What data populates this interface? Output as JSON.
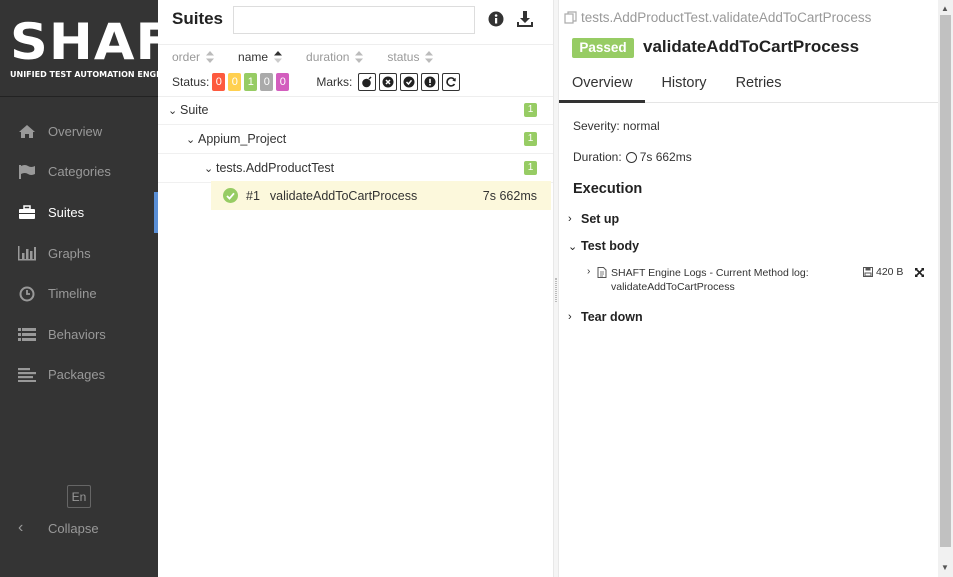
{
  "sidebar": {
    "logo_big": "SHAFT",
    "logo_small": "UNIFIED TEST AUTOMATION ENGINE",
    "items": [
      {
        "label": "Overview",
        "icon": "home-icon"
      },
      {
        "label": "Categories",
        "icon": "flag-icon"
      },
      {
        "label": "Suites",
        "icon": "briefcase-icon",
        "active": true
      },
      {
        "label": "Graphs",
        "icon": "bar-chart-icon"
      },
      {
        "label": "Timeline",
        "icon": "clock-icon"
      },
      {
        "label": "Behaviors",
        "icon": "list-icon"
      },
      {
        "label": "Packages",
        "icon": "align-left-icon"
      }
    ],
    "lang": "En",
    "collapse": "Collapse"
  },
  "suites": {
    "title": "Suites",
    "search_value": "",
    "sort": {
      "order": "order",
      "name": "name",
      "duration": "duration",
      "status": "status"
    },
    "status_label": "Status:",
    "status_counts": [
      {
        "value": "0",
        "color": "#fd5a3e"
      },
      {
        "value": "0",
        "color": "#ffd050"
      },
      {
        "value": "1",
        "color": "#97cc64"
      },
      {
        "value": "0",
        "color": "#aaaaaa"
      },
      {
        "value": "0",
        "color": "#d35ebe"
      }
    ],
    "marks_label": "Marks:",
    "tree": {
      "suite": {
        "label": "Suite",
        "count": "1"
      },
      "project": {
        "label": "Appium_Project",
        "count": "1"
      },
      "class": {
        "label": "tests.AddProductTest",
        "count": "1"
      },
      "testcase": {
        "num": "#1",
        "name": "validateAddToCartProcess",
        "duration": "7s 662ms"
      }
    }
  },
  "detail": {
    "breadcrumb": "tests.AddProductTest.validateAddToCartProcess",
    "status": "Passed",
    "title": "validateAddToCartProcess",
    "tabs": [
      "Overview",
      "History",
      "Retries"
    ],
    "severity": "Severity: normal",
    "duration_label": "Duration:",
    "duration_value": "7s 662ms",
    "execution": "Execution",
    "setup": "Set up",
    "testbody": "Test body",
    "attachment": {
      "name": "SHAFT Engine Logs - Current Method log: validateAddToCartProcess",
      "size": "420 B"
    },
    "teardown": "Tear down"
  },
  "colors": {
    "accent": "#5a8fd6",
    "passed": "#97cc64",
    "selected_row": "#fcf8dc"
  }
}
